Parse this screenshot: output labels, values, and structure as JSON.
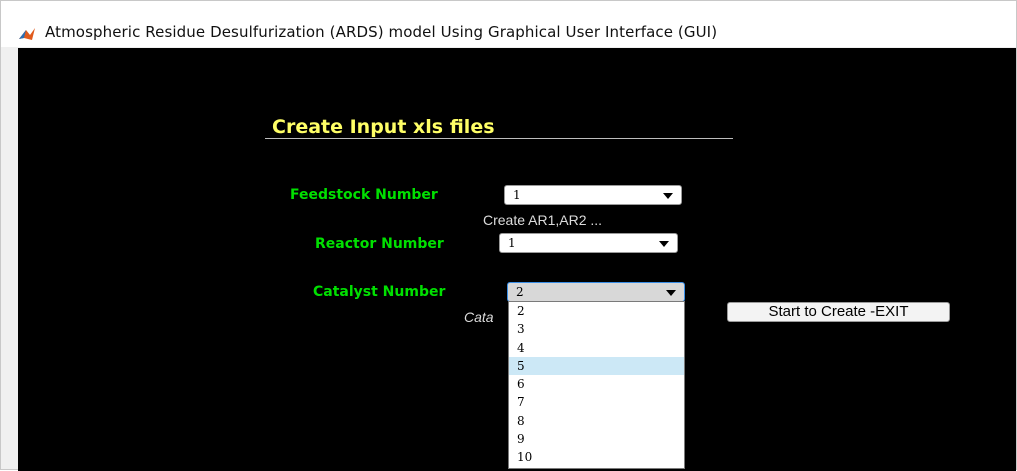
{
  "window": {
    "title": "Atmospheric Residue Desulfurization (ARDS) model  Using  Graphical  User Interface (GUI)",
    "icon": "matlab-icon"
  },
  "panel": {
    "title": "Create Input xls files"
  },
  "feedstock": {
    "label": "Feedstock Number",
    "value": "1",
    "hint": "Create AR1,AR2 ..."
  },
  "reactor": {
    "label": "Reactor Number",
    "value": "1"
  },
  "catalyst": {
    "label": "Catalyst  Number",
    "value": "2",
    "hint_partial": "Cata",
    "options": [
      "2",
      "3",
      "4",
      "5",
      "6",
      "7",
      "8",
      "9",
      "10"
    ],
    "highlighted_option": "5"
  },
  "actions": {
    "start_label": "Start to Create -EXIT"
  },
  "colors": {
    "background": "#000000",
    "label_green": "#00e000",
    "title_yellow": "#ffff66",
    "highlight": "#cce8f6"
  }
}
